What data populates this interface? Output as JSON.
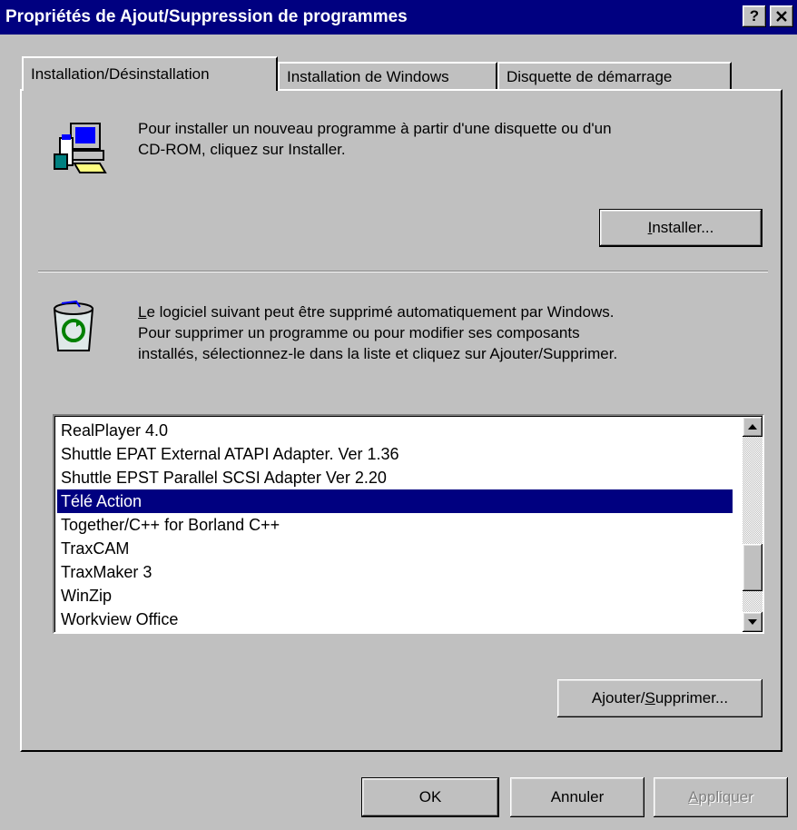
{
  "window": {
    "title": "Propriétés de Ajout/Suppression de programmes",
    "help_label": "?",
    "close_label": "×"
  },
  "tabs": [
    {
      "label": "Installation/Désinstallation",
      "active": true
    },
    {
      "label": "Installation de Windows",
      "active": false
    },
    {
      "label": "Disquette de démarrage",
      "active": false
    }
  ],
  "install_section": {
    "icon": "computer-disk-icon",
    "line1": "Pour installer un nouveau programme à partir d'une disquette ou d'un",
    "line2": "CD-ROM, cliquez sur Installer.",
    "button": {
      "mnemonic": "I",
      "rest": "nstaller..."
    }
  },
  "uninstall_section": {
    "icon": "recycle-bin-icon",
    "line1_mnemonic": "L",
    "line1_rest": "e logiciel suivant peut être supprimé automatiquement par Windows.",
    "line2": "Pour supprimer un programme ou pour modifier ses composants",
    "line3": "installés, sélectionnez-le dans la liste et cliquez sur Ajouter/Supprimer.",
    "button": {
      "before": "Ajouter/",
      "mnemonic": "S",
      "after": "upprimer..."
    }
  },
  "program_list": {
    "items": [
      "RealPlayer 4.0",
      "Shuttle EPAT External ATAPI Adapter. Ver 1.36",
      "Shuttle EPST Parallel SCSI Adapter Ver 2.20",
      "Télé Action",
      "Together/C++ for Borland C++",
      "TraxCAM",
      "TraxMaker 3",
      "WinZip",
      "Workview Office"
    ],
    "selected": "Télé Action"
  },
  "footer": {
    "ok": "OK",
    "cancel": "Annuler",
    "apply_mnemonic": "A",
    "apply_rest": "ppliquer"
  },
  "colors": {
    "title_bar": "#000080",
    "face": "#c0c0c0",
    "selection": "#000080"
  }
}
